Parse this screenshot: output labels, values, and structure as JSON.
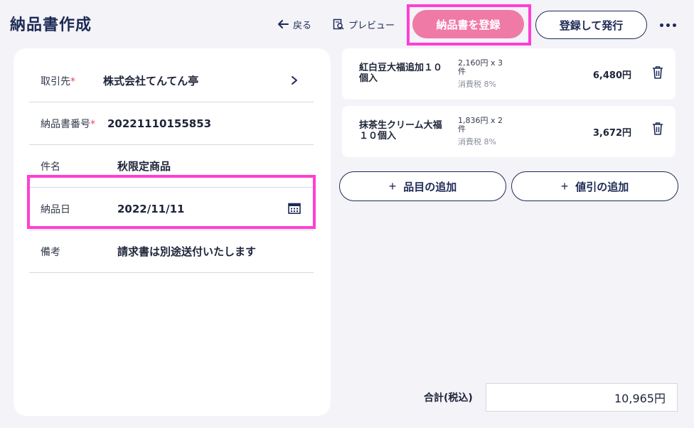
{
  "header": {
    "title": "納品書作成",
    "back_label": "戻る",
    "preview_label": "プレビュー",
    "register_label": "納品書を登録",
    "register_issue_label": "登録して発行"
  },
  "form": {
    "fields": [
      {
        "label": "取引先",
        "required": "*",
        "value": "株式会社てんてん亭"
      },
      {
        "label": "納品書番号",
        "required": "*",
        "value": "20221110155853"
      },
      {
        "label": "件名",
        "required": "",
        "value": "秋限定商品"
      },
      {
        "label": "納品日",
        "required": "",
        "value": "2022/11/11"
      },
      {
        "label": "備考",
        "required": "",
        "value": "請求書は別途送付いたします"
      }
    ]
  },
  "items": [
    {
      "name_1": "紅白豆大福追加１０",
      "name_2": "個入",
      "qty_1": "2,160円 x 3",
      "qty_2": "件",
      "tax": "消費税 8%",
      "amount": "6,480円"
    },
    {
      "name_1": "抹茶生クリーム大福",
      "name_2": "１０個入",
      "qty_1": "1,836円 x 2",
      "qty_2": "件",
      "tax": "消費税 8%",
      "amount": "3,672円"
    }
  ],
  "actions": {
    "add_item_label": "品目の追加",
    "add_discount_label": "値引の追加"
  },
  "total": {
    "label": "合計(税込)",
    "value": "10,965円"
  },
  "colors": {
    "accent_pink": "#ef7aa6",
    "highlight": "#ff3fd3",
    "navy": "#1e2a55",
    "required": "#e8456a"
  }
}
